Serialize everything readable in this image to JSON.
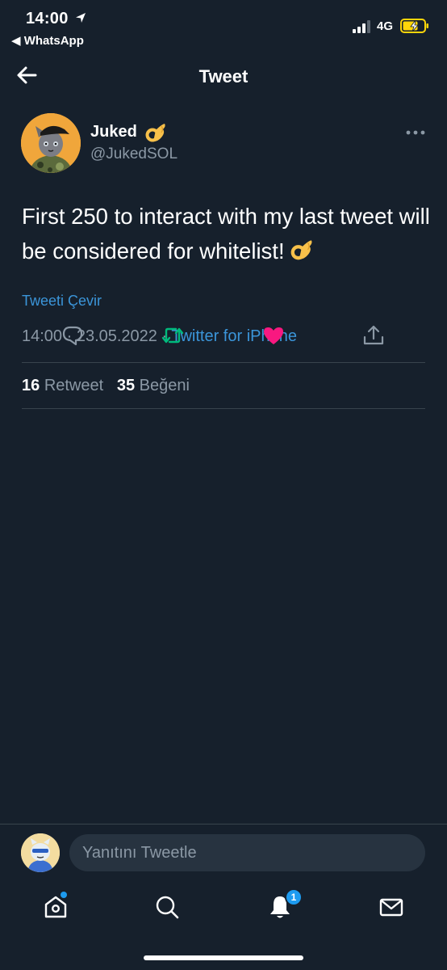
{
  "status_bar": {
    "time": "14:00",
    "back_app": "◀ WhatsApp",
    "network": "4G"
  },
  "nav": {
    "title": "Tweet"
  },
  "tweet": {
    "author_name": "Juked",
    "handle": "@JukedSOL",
    "text": "First 250 to interact with my last tweet will be considered for whitelist!",
    "translate_label": "Tweeti Çevir",
    "timestamp": "14:00 · 23.05.2022 · ",
    "source": "Twitter for iPhone",
    "retweet_count": "16",
    "retweet_label": "Retweet",
    "like_count": "35",
    "like_label": "Beğeni"
  },
  "actions": {
    "reply": "reply-icon",
    "retweet": "retweet-icon",
    "like": "heart-icon",
    "share": "share-icon"
  },
  "reply_bar": {
    "placeholder": "Yanıtını Tweetle"
  },
  "tab_bar": {
    "notification_badge": "1"
  },
  "colors": {
    "background": "#16202c",
    "accent": "#1d9bf0",
    "link": "#3b95d9",
    "retweet_green": "#00ba7c",
    "like_pink": "#f91880",
    "secondary_text": "#8b98a5"
  }
}
